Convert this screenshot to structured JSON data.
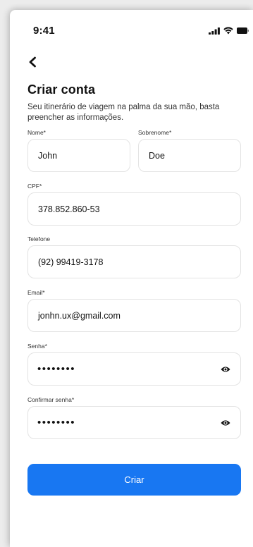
{
  "status_bar": {
    "time": "9:41"
  },
  "header": {
    "back_icon": "chevron-left-icon",
    "title": "Criar conta",
    "subtitle": "Seu itinerário de viagem na palma da sua mão, basta preencher as informações."
  },
  "form": {
    "nome": {
      "label": "Nome*",
      "value": "John"
    },
    "sobrenome": {
      "label": "Sobrenome*",
      "value": "Doe"
    },
    "cpf": {
      "label": "CPF*",
      "value": "378.852.860-53"
    },
    "telefone": {
      "label": "Telefone",
      "value": "(92) 99419-3178"
    },
    "email": {
      "label": "Email*",
      "value": "jonhn.ux@gmail.com"
    },
    "senha": {
      "label": "Senha*",
      "value": "••••••••",
      "toggle_icon": "eye-icon"
    },
    "confirmar_senha": {
      "label": "Confirmar senha*",
      "value": "••••••••",
      "toggle_icon": "eye-icon"
    }
  },
  "actions": {
    "submit_label": "Criar"
  },
  "colors": {
    "primary": "#1877f2",
    "border": "#e3e3e3",
    "text": "#111111"
  }
}
